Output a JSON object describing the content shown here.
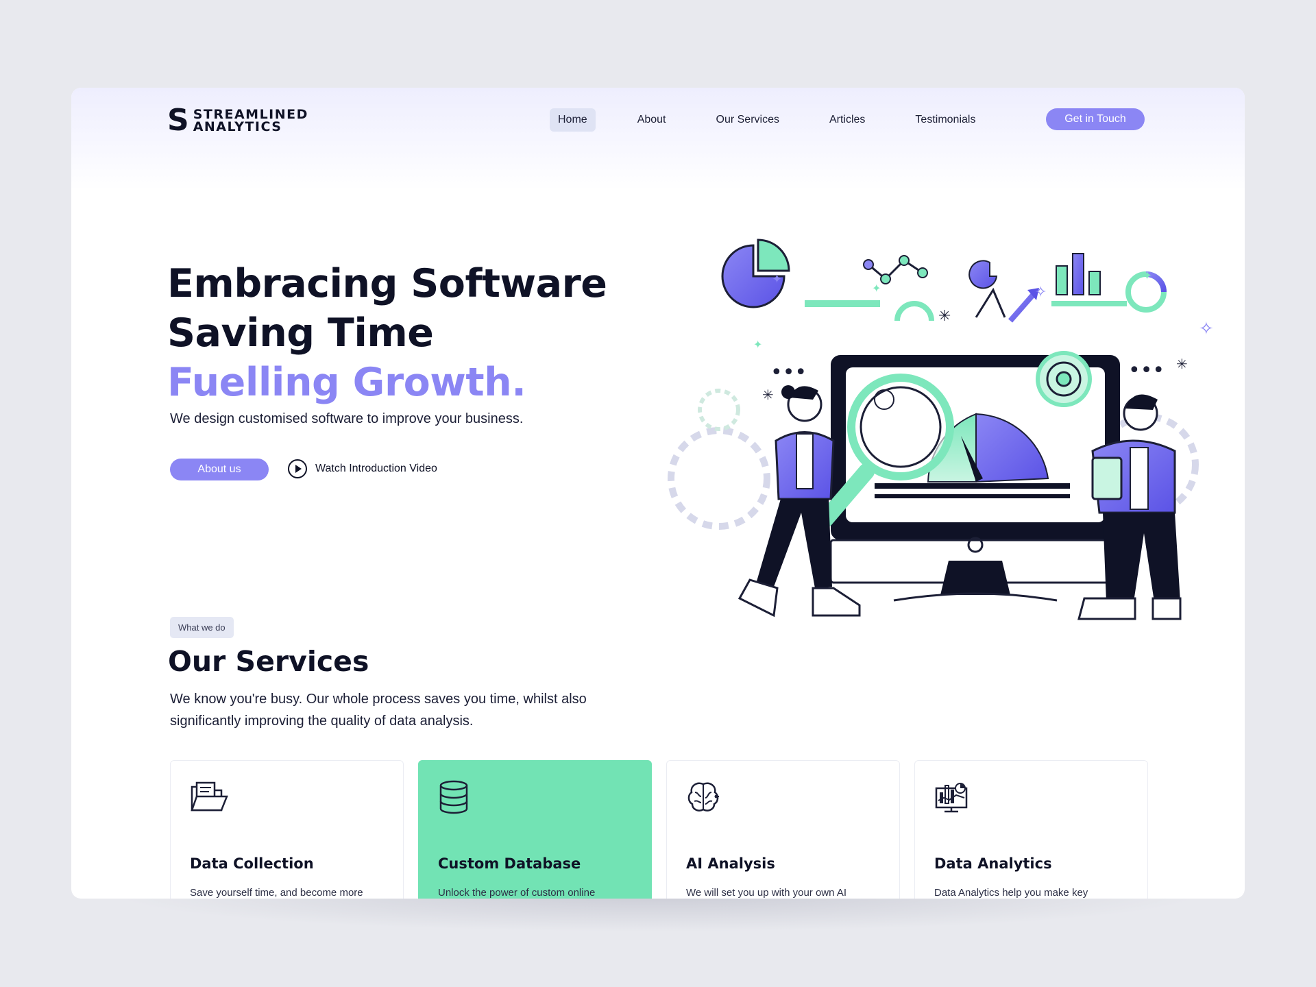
{
  "brand": {
    "line1": "STREAMLINED",
    "line2": "ANALYTICS",
    "mark": "S"
  },
  "nav": {
    "items": [
      "Home",
      "About",
      "Our Services",
      "Articles",
      "Testimonials"
    ],
    "active": "Home",
    "cta": "Get in Touch"
  },
  "hero": {
    "title_line1": "Embracing Software",
    "title_line2": "Saving Time",
    "title_line3": "Fuelling Growth.",
    "subtitle": "We design customised software to improve your business.",
    "primary_button": "About us",
    "video_link": "Watch Introduction Video"
  },
  "services": {
    "tag": "What we do",
    "title": "Our Services",
    "description": "We know you're busy. Our whole process saves you time, whilst also significantly improving the quality of data analysis.",
    "cards": [
      {
        "title": "Data Collection",
        "text": "Save yourself time, and become more",
        "icon": "folder-icon"
      },
      {
        "title": "Custom Database",
        "text": "Unlock the power of custom online",
        "icon": "database-icon"
      },
      {
        "title": "AI Analysis",
        "text": "We will set you up with your own AI",
        "icon": "brain-icon"
      },
      {
        "title": "Data Analytics",
        "text": "Data Analytics help you make key",
        "icon": "analytics-monitor-icon"
      }
    ]
  },
  "colors": {
    "accent": "#8b86f4",
    "highlight": "#72e3b4",
    "ink": "#0f1226",
    "background": "#e8e9ee"
  }
}
